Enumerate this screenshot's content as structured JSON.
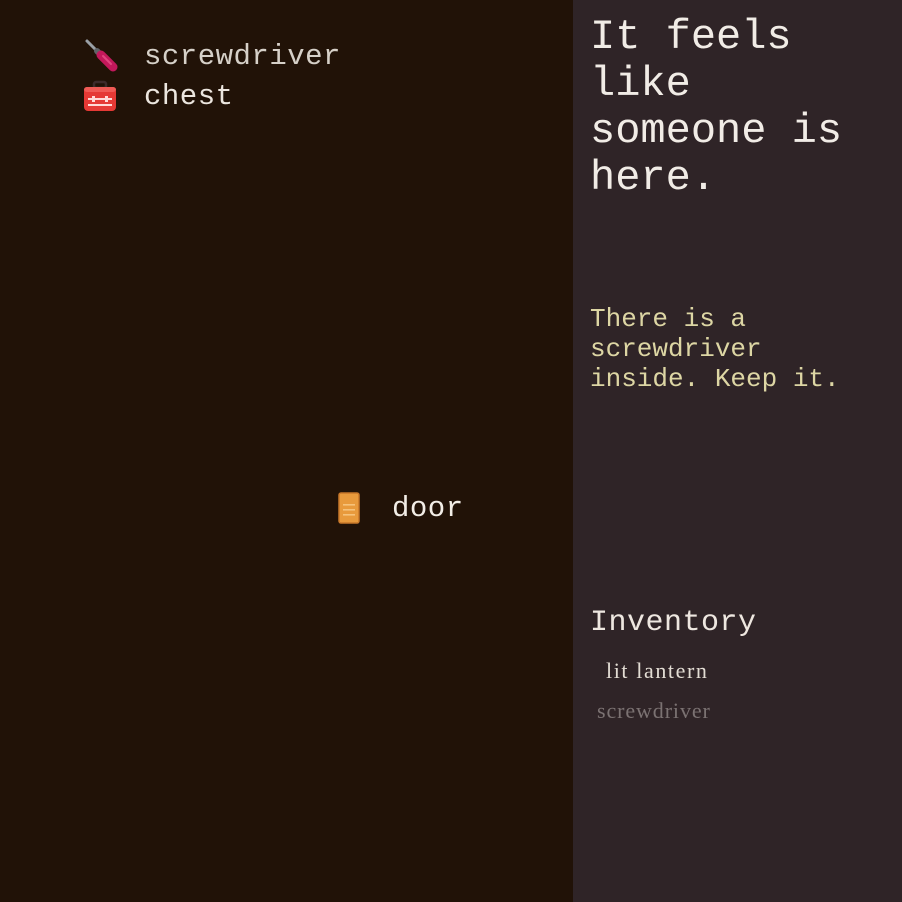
{
  "scene": {
    "objects": [
      {
        "id": "screwdriver",
        "label": "screwdriver",
        "icon": "screwdriver-icon"
      },
      {
        "id": "chest",
        "label": "chest",
        "icon": "toolbox-icon"
      },
      {
        "id": "door",
        "label": "door",
        "icon": "door-icon"
      }
    ]
  },
  "panel": {
    "headline": "It feels\nlike\nsomeone is\nhere.",
    "message": "There is a\nscrewdriver\ninside. Keep it.",
    "inventory": {
      "title": "Inventory",
      "items": [
        {
          "label": "lit lantern",
          "state": "active"
        },
        {
          "label": "screwdriver",
          "state": "dim"
        }
      ]
    }
  },
  "colors": {
    "scene_background": "#211207",
    "panel_background": "#2f2427",
    "message_text": "#ddd6a4",
    "screwdriver_handle": "#c2185b",
    "chest_red": "#e53935",
    "door_orange": "#e89a3c"
  }
}
